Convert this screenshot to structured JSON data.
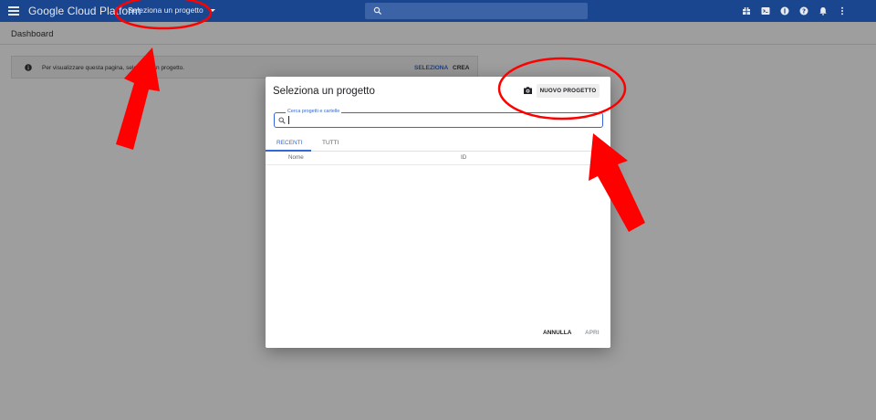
{
  "topbar": {
    "brand": "Google Cloud Platform",
    "project_selector": "Seleziona un progetto",
    "icons": [
      "menu-icon",
      "search-icon",
      "gift-icon",
      "terminal-icon",
      "notes-icon",
      "help-icon",
      "bell-icon",
      "more-vert-icon"
    ]
  },
  "page": {
    "title": "Dashboard"
  },
  "banner": {
    "text": "Per visualizzare questa pagina, seleziona un progetto.",
    "select_label": "SELEZIONA",
    "create_label": "CREA"
  },
  "dialog": {
    "title": "Seleziona un progetto",
    "new_project_label": "NUOVO PROGETTO",
    "search_label": "Cerca progetti e cartelle",
    "search_value": "",
    "tabs": [
      "RECENTI",
      "TUTTI"
    ],
    "active_tab": "RECENTI",
    "columns": [
      "Nome",
      "ID"
    ],
    "cancel_label": "ANNULLA",
    "open_label": "APRI"
  },
  "colors": {
    "topbar": "#19468f",
    "accent": "#3367d6",
    "overlay": "#9e9e9e",
    "annotation": "#ff0000"
  }
}
